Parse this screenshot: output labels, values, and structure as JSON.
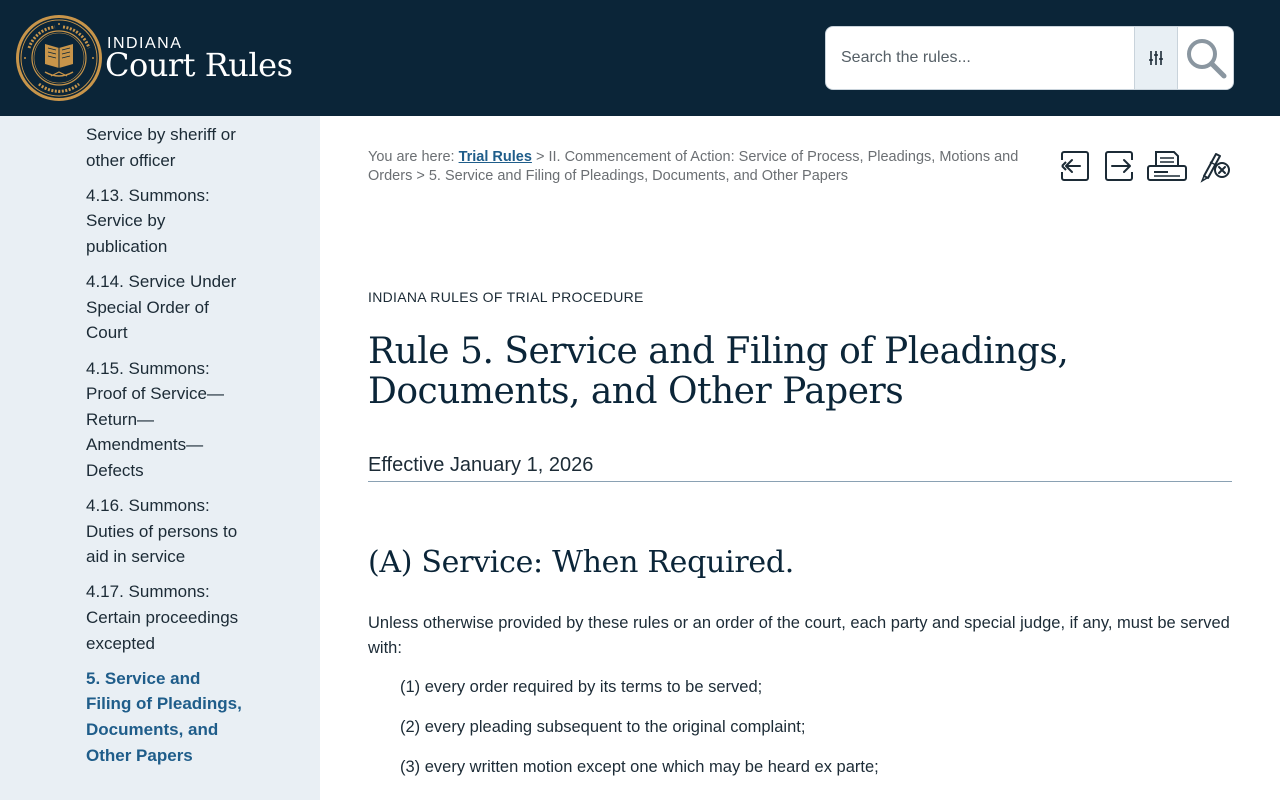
{
  "header": {
    "brand_small": "INDIANA",
    "brand_big": "Court Rules",
    "search_placeholder": "Search the rules..."
  },
  "sidebar": {
    "items": [
      {
        "label": "Service by sheriff or other officer",
        "active": false
      },
      {
        "label": "4.13. Summons: Service by publication",
        "active": false
      },
      {
        "label": "4.14. Service Under Special Order of Court",
        "active": false
      },
      {
        "label": "4.15. Summons: Proof of Service—Return—Amendments—Defects",
        "active": false
      },
      {
        "label": "4.16. Summons: Duties of persons to aid in service",
        "active": false
      },
      {
        "label": "4.17. Summons: Certain proceedings excepted",
        "active": false
      },
      {
        "label": "5. Service and Filing of Pleadings, Documents, and Other Papers",
        "active": true
      }
    ]
  },
  "breadcrumb": {
    "prefix": "You are here:",
    "link": "Trial Rules",
    "sep": ">",
    "section": "II. Commencement of Action: Service of Process, Pleadings, Motions and Orders",
    "current": "5. Service and Filing of Pleadings, Documents, and Other Papers"
  },
  "content": {
    "eyebrow": "INDIANA RULES OF TRIAL PROCEDURE",
    "title": "Rule 5. Service and Filing of Pleadings, Documents, and Other Papers",
    "effective": "Effective January 1, 2026",
    "section_title": "(A) Service: When Required.",
    "intro": "Unless otherwise provided by these rules or an order of the court, each party and special judge, if any, must be served with:",
    "list": [
      "(1) every order required by its terms to be served;",
      "(2) every pleading subsequent to the original complaint;",
      "(3) every written motion except one which may be heard ex parte;"
    ]
  },
  "colors": {
    "header_bg": "#0b2538",
    "seal_gold": "#c8954a",
    "sidebar_bg": "#e9eff4",
    "link": "#1f5d8a"
  }
}
